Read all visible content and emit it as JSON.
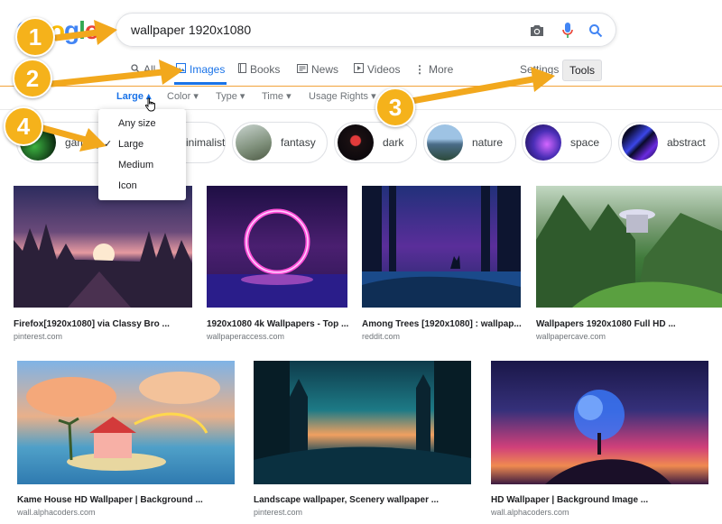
{
  "search": {
    "query": "wallpaper 1920x1080"
  },
  "logo": {
    "letters": [
      "G",
      "o",
      "o",
      "g",
      "l",
      "e"
    ]
  },
  "tabs": [
    {
      "label": "All",
      "icon": "search-icon"
    },
    {
      "label": "Images",
      "icon": "image-icon"
    },
    {
      "label": "Books",
      "icon": "book-icon"
    },
    {
      "label": "News",
      "icon": "news-icon"
    },
    {
      "label": "Videos",
      "icon": "play-icon"
    },
    {
      "label": "More",
      "icon": "kebab-icon"
    }
  ],
  "settings_label": "Settings",
  "tools_label": "Tools",
  "filters": [
    {
      "label": "Large"
    },
    {
      "label": "Color"
    },
    {
      "label": "Type"
    },
    {
      "label": "Time"
    },
    {
      "label": "Usage Rights"
    }
  ],
  "size_menu": {
    "items": [
      "Any size",
      "Large",
      "Medium",
      "Icon"
    ],
    "selected": "Large"
  },
  "chips": [
    "gaming",
    "minimalist",
    "fantasy",
    "dark",
    "nature",
    "space",
    "abstract"
  ],
  "results": [
    {
      "title": "Firefox[1920x1080] via Classy Bro ...",
      "source": "pinterest.com"
    },
    {
      "title": "1920x1080 4k Wallpapers - Top ...",
      "source": "wallpaperaccess.com"
    },
    {
      "title": "Among Trees [1920x1080] : wallpap...",
      "source": "reddit.com"
    },
    {
      "title": "Wallpapers 1920x1080 Full HD ...",
      "source": "wallpapercave.com"
    },
    {
      "title": "Kame House HD Wallpaper | Background ...",
      "source": "wall.alphacoders.com"
    },
    {
      "title": "Landscape wallpaper, Scenery wallpaper ...",
      "source": "pinterest.com"
    },
    {
      "title": "HD Wallpaper | Background Image ...",
      "source": "wall.alphacoders.com"
    }
  ],
  "annotations": [
    "1",
    "2",
    "3",
    "4"
  ],
  "colors": {
    "accent": "#1a73e8",
    "badge": "#f5b21b",
    "arrow": "#f2a81d"
  }
}
